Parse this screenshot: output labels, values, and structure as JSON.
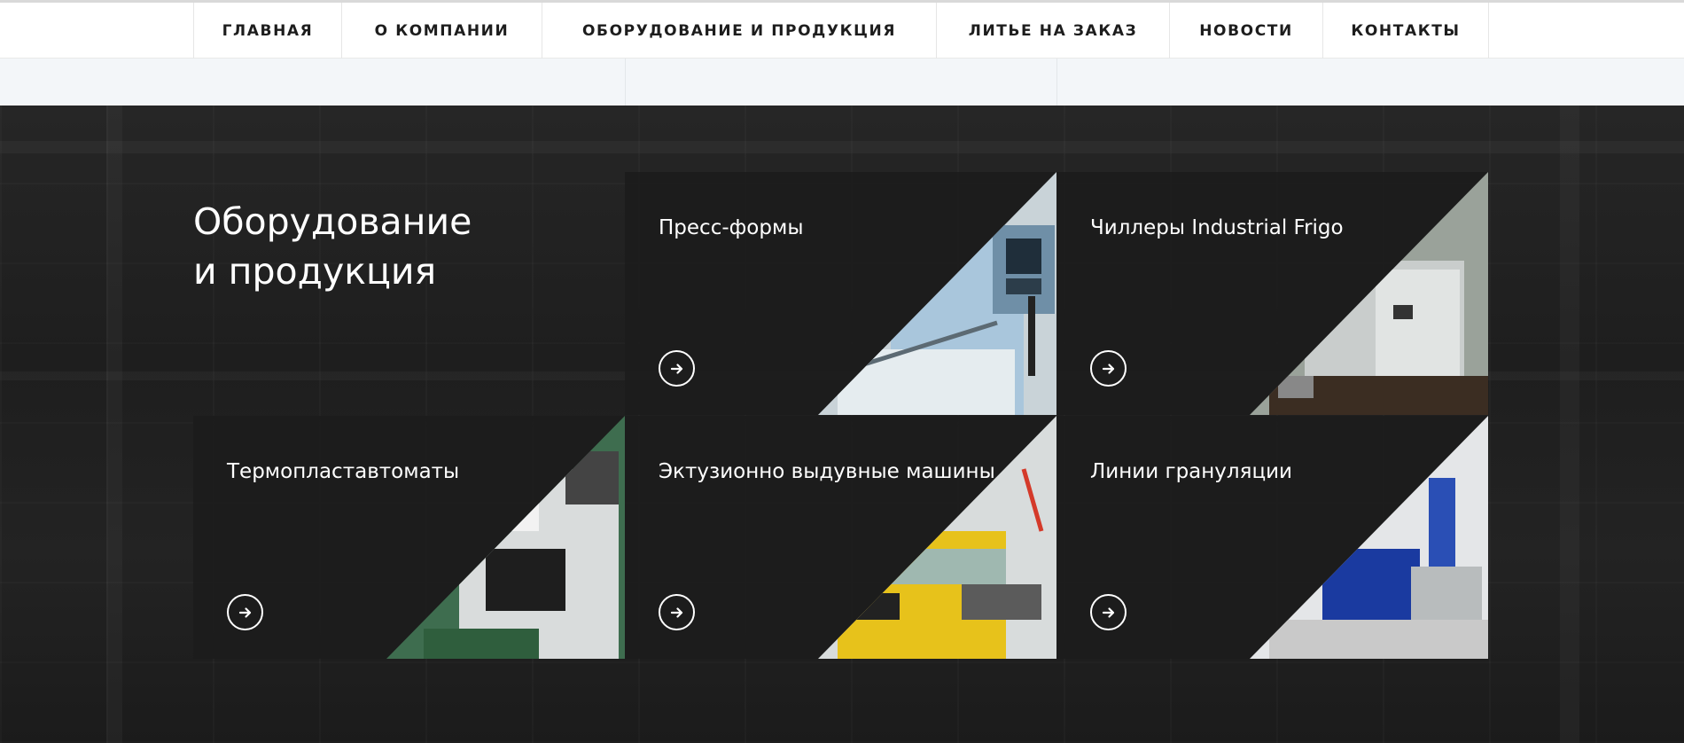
{
  "nav": {
    "items": [
      {
        "label": "ГЛАВНАЯ"
      },
      {
        "label": "О КОМПАНИИ"
      },
      {
        "label": "ОБОРУДОВАНИЕ И ПРОДУКЦИЯ"
      },
      {
        "label": "ЛИТЬЕ НА ЗАКАЗ"
      },
      {
        "label": "НОВОСТИ"
      },
      {
        "label": "КОНТАКТЫ"
      }
    ]
  },
  "section": {
    "title_line1": "Оборудование",
    "title_line2": "и продукция"
  },
  "cards": [
    {
      "label": "Пресс-формы",
      "icon": "arrow-right-icon"
    },
    {
      "label": "Чиллеры Industrial Frigo",
      "icon": "arrow-right-icon"
    },
    {
      "label": "Термопластавтоматы",
      "icon": "arrow-right-icon"
    },
    {
      "label": "Эктузионно выдувные машины",
      "icon": "arrow-right-icon"
    },
    {
      "label": "Линии грануляции",
      "icon": "arrow-right-icon"
    }
  ],
  "colors": {
    "nav_text": "#1d1d1d",
    "dark_bg": "#1e1e1e",
    "card_bg": "#1c1c1c",
    "text_light": "#ffffff"
  }
}
